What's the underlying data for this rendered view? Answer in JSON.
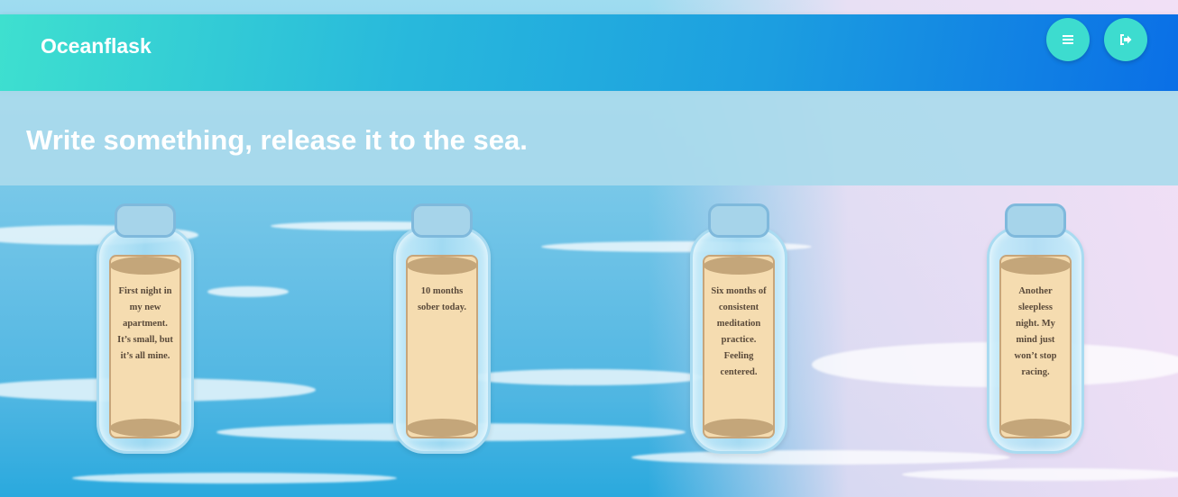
{
  "app": {
    "title": "Oceanflask"
  },
  "header": {
    "menu_icon": "menu-icon",
    "logout_icon": "logout-icon"
  },
  "prompt": {
    "text": "Write something, release it to the sea."
  },
  "bottles": [
    {
      "note": "First night in my new apartment. It’s small, but it’s all mine."
    },
    {
      "note": "10 months sober today."
    },
    {
      "note": "Six months of consistent meditation practice. Feeling centered."
    },
    {
      "note": "Another sleepless night. My mind just won’t stop racing."
    }
  ],
  "colors": {
    "header_start": "#3ee0cf",
    "header_end": "#0a6fe6",
    "button": "#3ddccf",
    "scroll": "#f5dcb0"
  }
}
